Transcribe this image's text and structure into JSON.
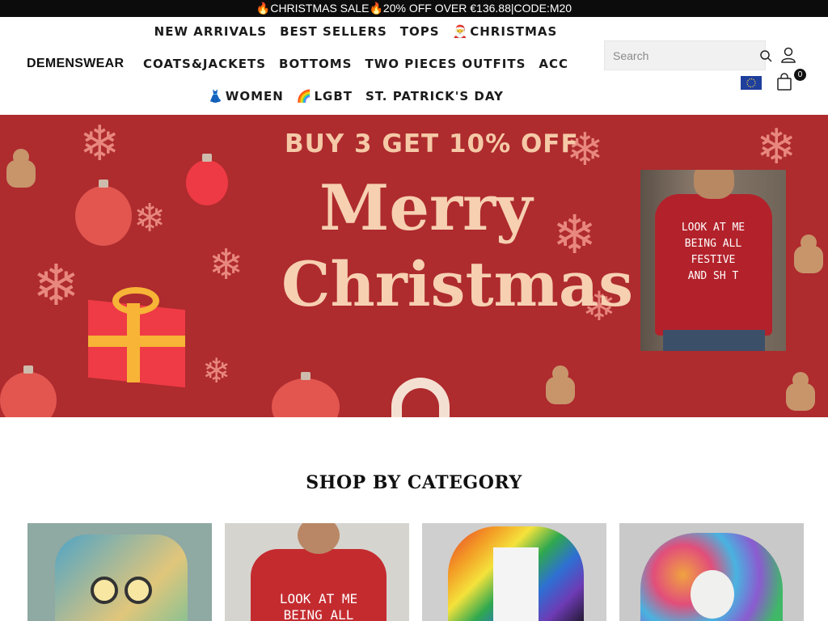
{
  "announcement": "🔥CHRISTMAS SALE🔥20% OFF OVER €136.88|CODE:M20",
  "brand": {
    "logo": "DEMENSWEAR"
  },
  "nav": {
    "row1": [
      {
        "label": "NEW ARRIVALS",
        "icon": ""
      },
      {
        "label": "BEST SELLERS",
        "icon": ""
      },
      {
        "label": "TOPS",
        "icon": ""
      },
      {
        "label": "CHRISTMAS",
        "icon": "🎅"
      }
    ],
    "row2": [
      {
        "label": "COATS&JACKETS",
        "icon": ""
      },
      {
        "label": "BOTTOMS",
        "icon": ""
      },
      {
        "label": "TWO PIECES OUTFITS",
        "icon": ""
      },
      {
        "label": "ACC",
        "icon": ""
      }
    ],
    "row3": [
      {
        "label": "WOMEN",
        "icon": "👗"
      },
      {
        "label": "LGBT",
        "icon": "🌈"
      },
      {
        "label": "ST. PATRICK'S DAY",
        "icon": ""
      }
    ]
  },
  "search": {
    "placeholder": "Search",
    "icon": "search-icon"
  },
  "account": {
    "icon": "user-icon"
  },
  "region": {
    "flag": "eu-flag",
    "color": "#1f3f9c"
  },
  "cart": {
    "icon": "shopping-bag-icon",
    "count": "0"
  },
  "hero": {
    "headline": "BUY 3 GET 10% OFF",
    "title_line1": "Merry",
    "title_line2": "Christmas",
    "shirt_text": [
      "LOOK AT ME",
      "BEING ALL",
      "FESTIVE",
      "AND SH T"
    ],
    "background": "#ae2b2e"
  },
  "category_section": {
    "title": "SHOP BY CATEGORY",
    "tiles": [
      {
        "icon": "owl-sweater-image"
      },
      {
        "icon": "festive-tee-image",
        "text": [
          "LOOK AT ME",
          "BEING ALL"
        ]
      },
      {
        "icon": "rainbow-jacket-image"
      },
      {
        "icon": "colorful-hoodie-image"
      }
    ]
  }
}
